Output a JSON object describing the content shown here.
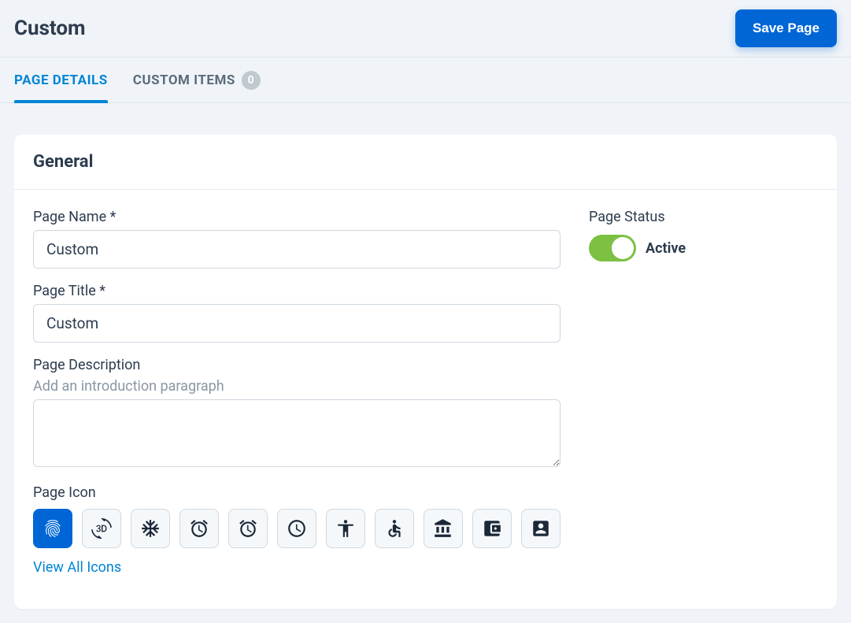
{
  "header": {
    "title": "Custom",
    "save_label": "Save Page"
  },
  "tabs": {
    "page_details": "PAGE DETAILS",
    "custom_items": "CUSTOM ITEMS",
    "custom_items_count": "0"
  },
  "general": {
    "heading": "General",
    "page_name_label": "Page Name *",
    "page_name_value": "Custom",
    "page_title_label": "Page Title *",
    "page_title_value": "Custom",
    "page_description_label": "Page Description",
    "page_description_hint": "Add an introduction paragraph",
    "page_description_value": "",
    "page_icon_label": "Page Icon",
    "view_all_icons": "View All Icons",
    "icons": [
      "fingerprint-icon",
      "rotation-3d-icon",
      "ac-unit-icon",
      "access-alarm-icon",
      "access-alarms-icon",
      "access-time-icon",
      "accessibility-icon",
      "accessible-icon",
      "account-balance-icon",
      "account-balance-wallet-icon",
      "account-box-icon"
    ],
    "selected_icon_index": 0
  },
  "status": {
    "label": "Page Status",
    "active_label": "Active",
    "is_active": true
  }
}
